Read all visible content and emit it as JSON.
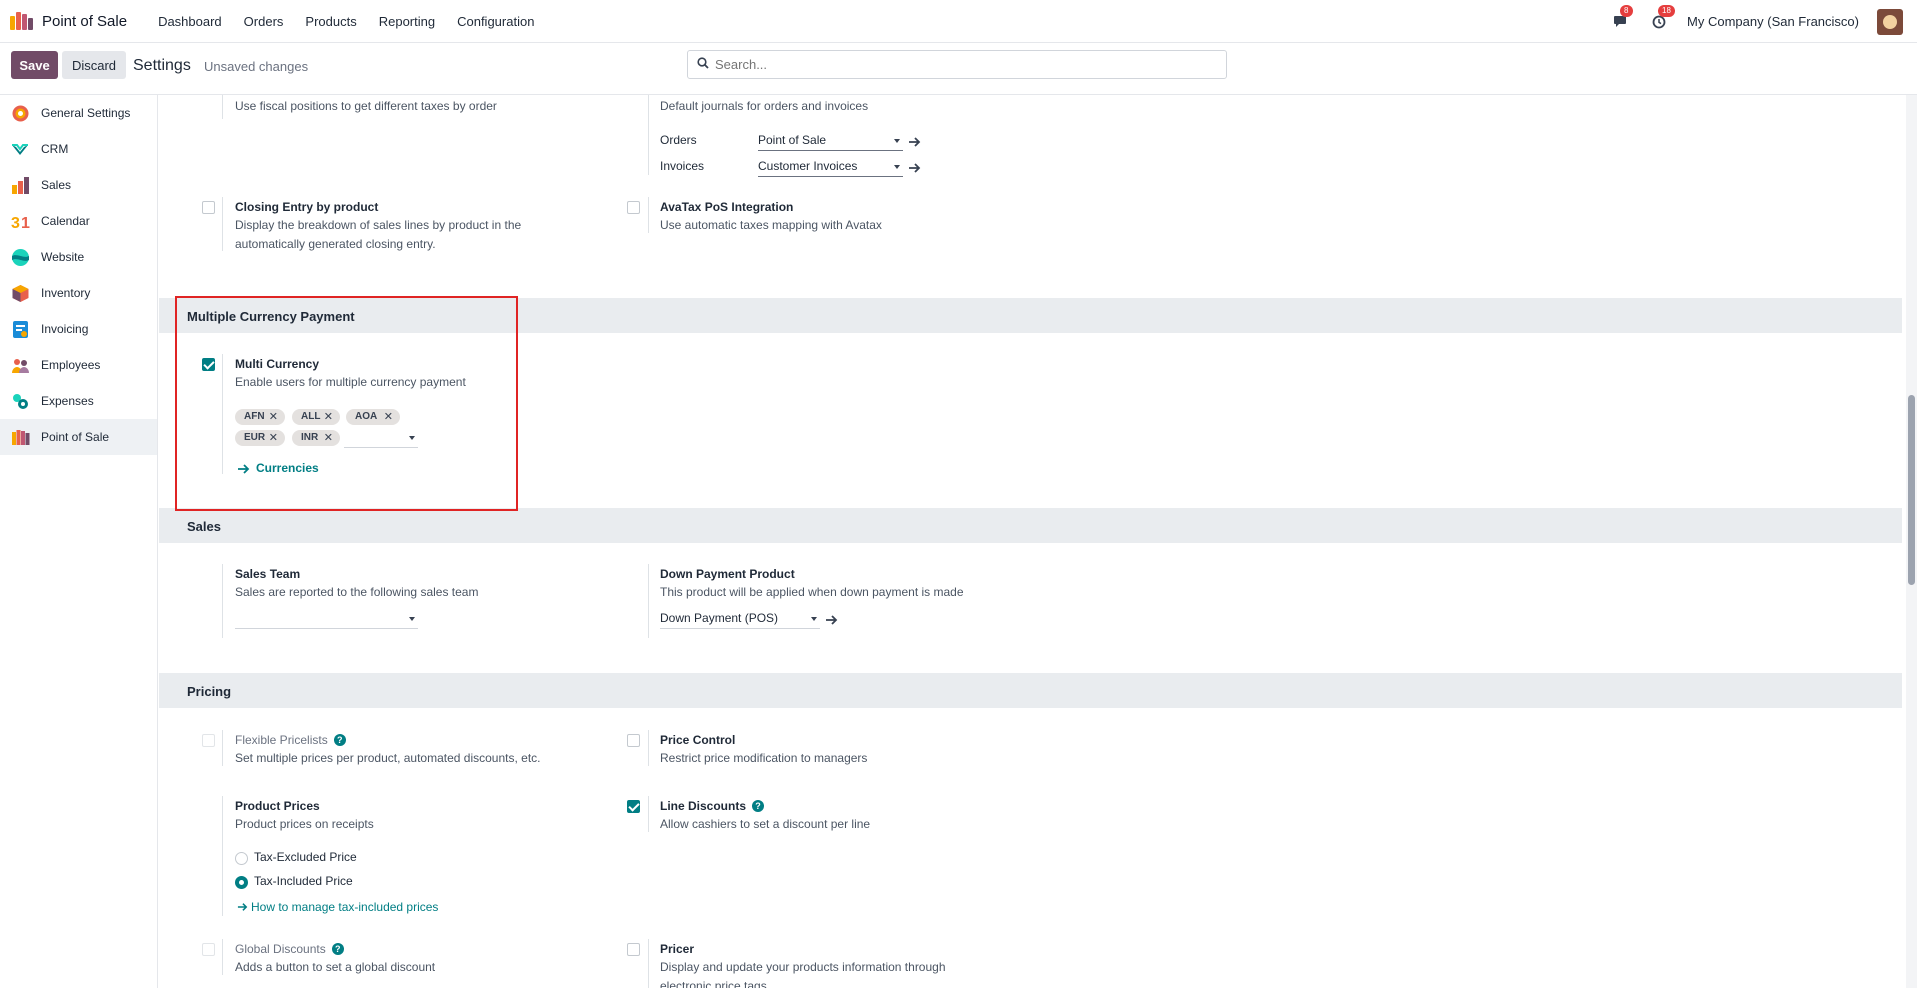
{
  "navbar": {
    "app_name": "Point of Sale",
    "menu": [
      "Dashboard",
      "Orders",
      "Products",
      "Reporting",
      "Configuration"
    ],
    "chat_badge": "8",
    "activity_badge": "18",
    "company": "My Company (San Francisco)"
  },
  "control_panel": {
    "save_label": "Save",
    "discard_label": "Discard",
    "title": "Settings",
    "status": "Unsaved changes",
    "search_placeholder": "Search..."
  },
  "sidebar": {
    "items": [
      {
        "label": "General Settings",
        "icon": "general-settings-icon"
      },
      {
        "label": "CRM",
        "icon": "crm-icon"
      },
      {
        "label": "Sales",
        "icon": "sales-icon"
      },
      {
        "label": "Calendar",
        "icon": "calendar-icon"
      },
      {
        "label": "Website",
        "icon": "website-icon"
      },
      {
        "label": "Inventory",
        "icon": "inventory-icon"
      },
      {
        "label": "Invoicing",
        "icon": "invoicing-icon"
      },
      {
        "label": "Employees",
        "icon": "employees-icon"
      },
      {
        "label": "Expenses",
        "icon": "expenses-icon"
      },
      {
        "label": "Point of Sale",
        "icon": "pos-icon",
        "active": true
      }
    ]
  },
  "accounting": {
    "fiscal_desc": "Use fiscal positions to get different taxes by order",
    "journals_desc": "Default journals for orders and invoices",
    "orders_label": "Orders",
    "orders_value": "Point of Sale",
    "invoices_label": "Invoices",
    "invoices_value": "Customer Invoices",
    "closing_title": "Closing Entry by product",
    "closing_desc": "Display the breakdown of sales lines by product in the automatically generated closing entry.",
    "avatax_title": "AvaTax PoS Integration",
    "avatax_desc": "Use automatic taxes mapping with Avatax"
  },
  "multi_currency": {
    "section_title": "Multiple Currency Payment",
    "title": "Multi Currency",
    "desc": "Enable users for multiple currency payment",
    "checked": true,
    "tags": [
      "AFN",
      "ALL",
      "AOA",
      "EUR",
      "INR"
    ],
    "link": "Currencies"
  },
  "sales": {
    "section_title": "Sales",
    "team_title": "Sales Team",
    "team_desc": "Sales are reported to the following sales team",
    "down_title": "Down Payment Product",
    "down_desc": "This product will be applied when down payment is made",
    "down_value": "Down Payment (POS)"
  },
  "pricing": {
    "section_title": "Pricing",
    "flex_title": "Flexible Pricelists",
    "flex_desc": "Set multiple prices per product, automated discounts, etc.",
    "price_control_title": "Price Control",
    "price_control_desc": "Restrict price modification to managers",
    "product_prices_title": "Product Prices",
    "product_prices_desc": "Product prices on receipts",
    "tax_excluded": "Tax-Excluded Price",
    "tax_included": "Tax-Included Price",
    "tax_link": "How to manage tax-included prices",
    "line_discounts_title": "Line Discounts",
    "line_discounts_desc": "Allow cashiers to set a discount per line",
    "global_title": "Global Discounts",
    "global_desc": "Adds a button to set a global discount",
    "pricer_title": "Pricer",
    "pricer_desc": "Display and update your products information through electronic price tags"
  },
  "colors": {
    "brand": "#714b67",
    "accent": "#017e84",
    "highlight": "#e02424"
  }
}
